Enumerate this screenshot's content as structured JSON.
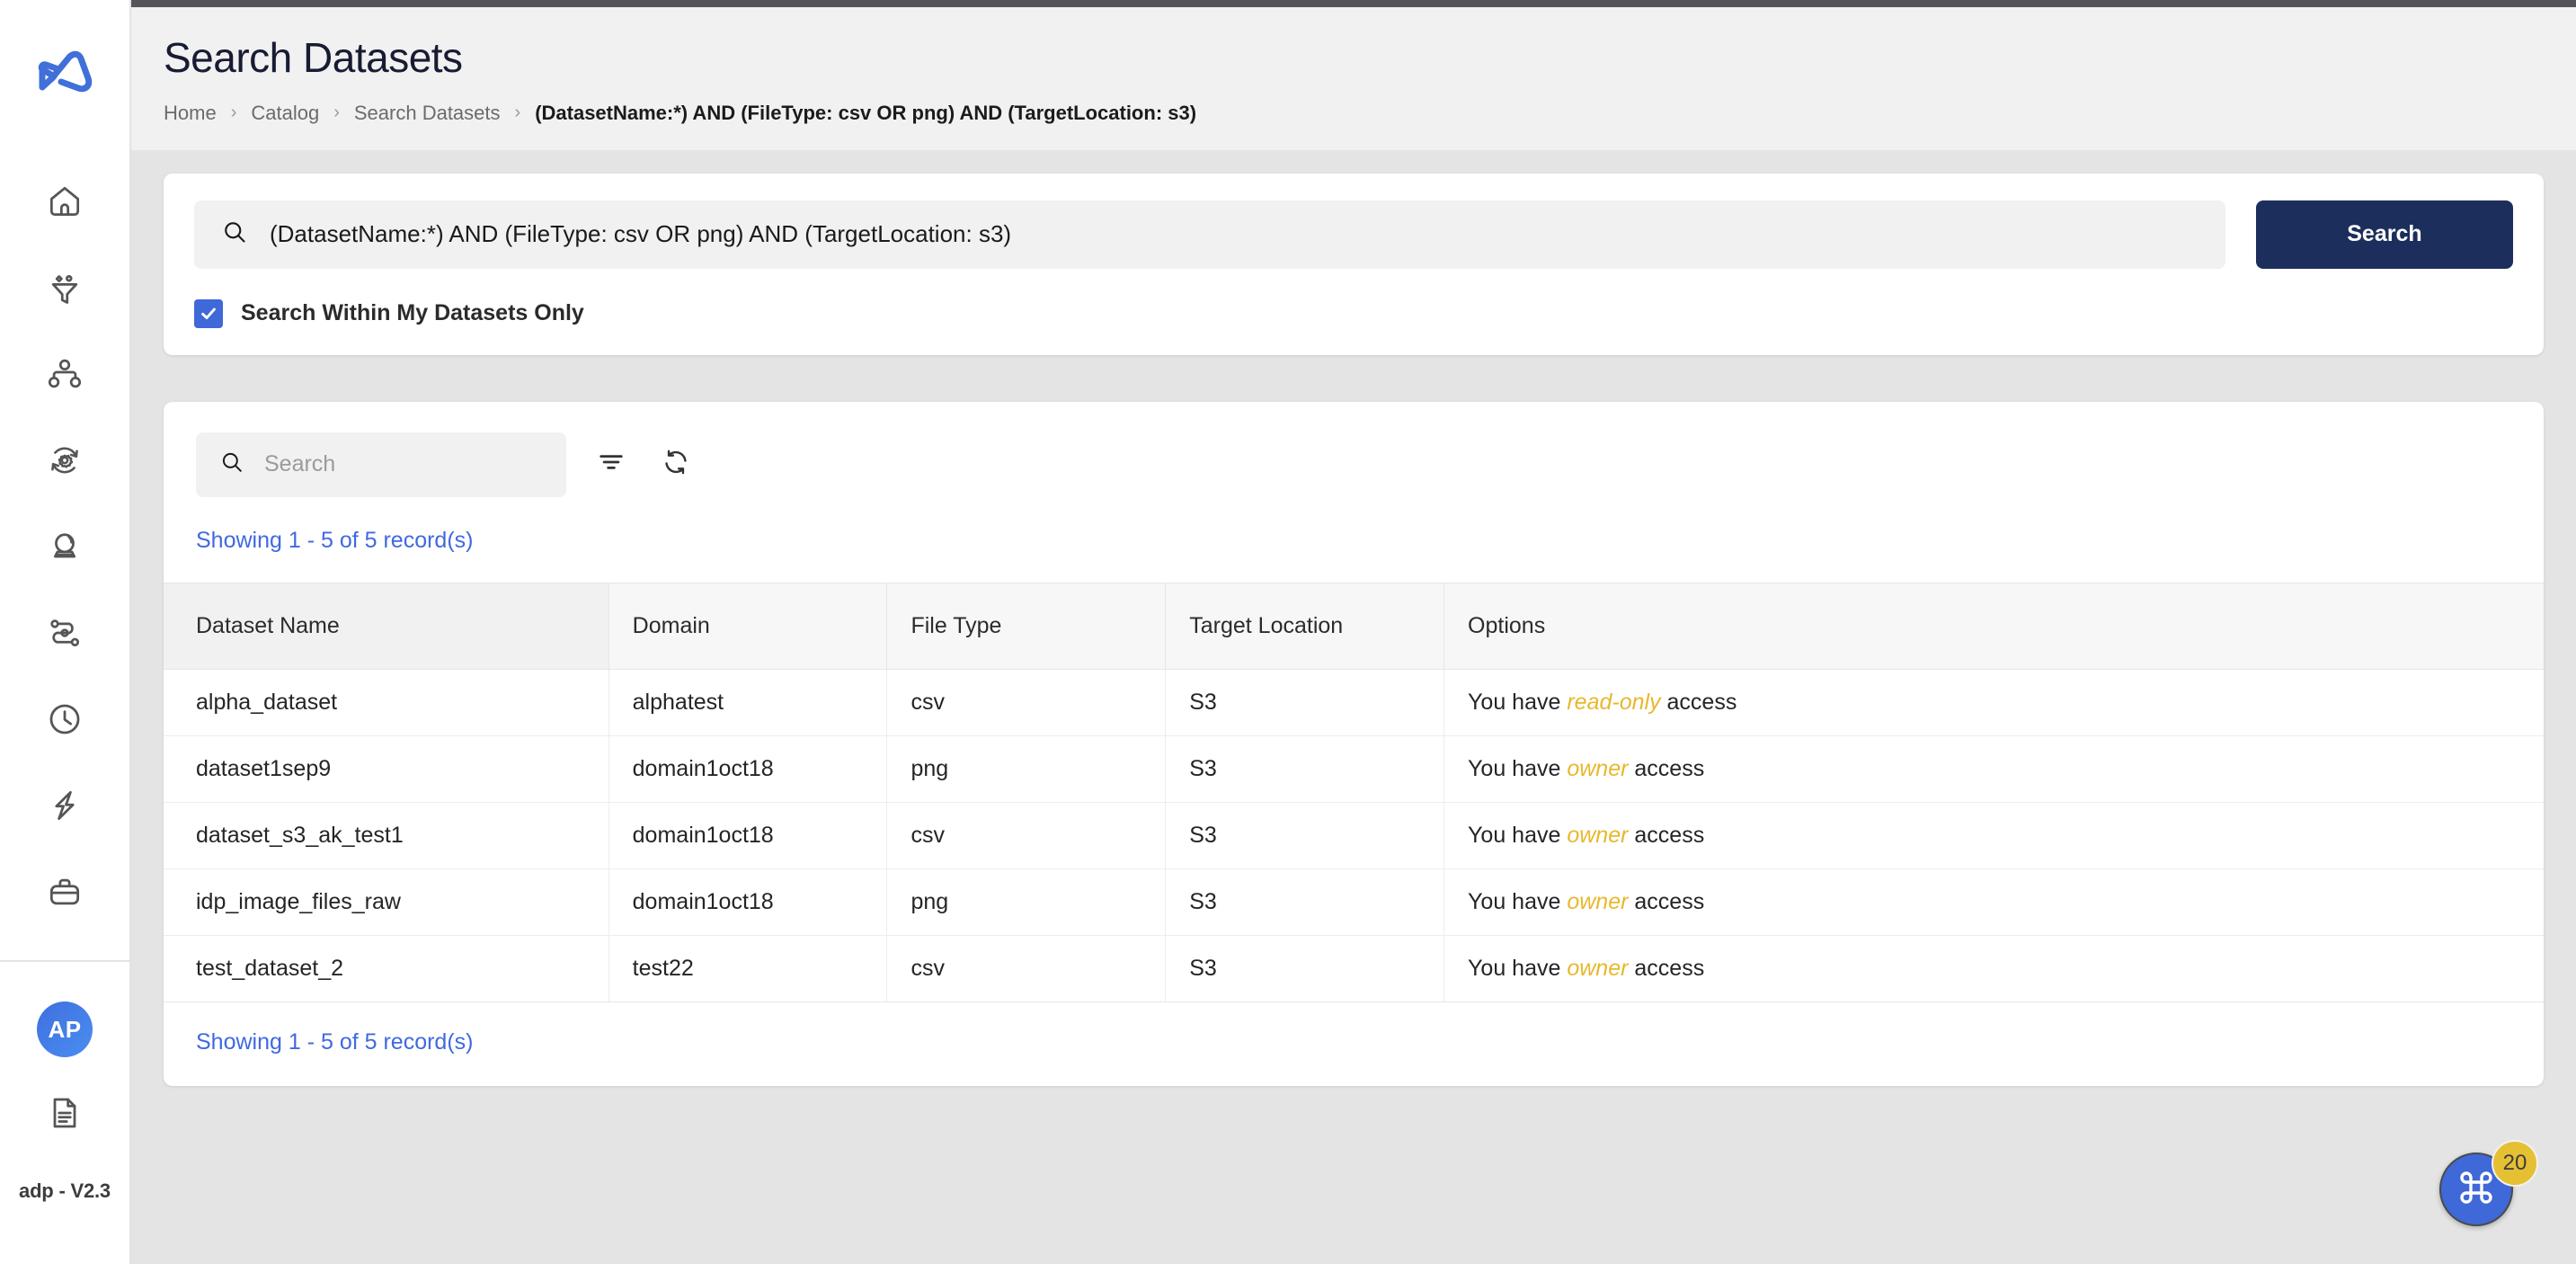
{
  "app": {
    "logo_icon": "adp-logo-icon",
    "version_label": "adp - V2.3",
    "avatar_initials": "AP"
  },
  "sidebar": {
    "items": [
      {
        "name": "home",
        "icon": "home-icon"
      },
      {
        "name": "filter",
        "icon": "funnel-icon"
      },
      {
        "name": "catalog",
        "icon": "hierarchy-icon"
      },
      {
        "name": "processing",
        "icon": "gear-refresh-icon"
      },
      {
        "name": "insights",
        "icon": "crystal-ball-icon"
      },
      {
        "name": "pipelines",
        "icon": "workflow-path-icon"
      },
      {
        "name": "scheduler",
        "icon": "clock-icon"
      },
      {
        "name": "jobs",
        "icon": "lightning-bolt-icon"
      },
      {
        "name": "workspace",
        "icon": "briefcase-icon"
      }
    ],
    "footer_items": [
      {
        "name": "user-avatar",
        "icon": "avatar-icon"
      },
      {
        "name": "docs",
        "icon": "document-icon"
      }
    ]
  },
  "header": {
    "title": "Search Datasets",
    "breadcrumb": [
      {
        "label": "Home",
        "current": false
      },
      {
        "label": "Catalog",
        "current": false
      },
      {
        "label": "Search Datasets",
        "current": false
      },
      {
        "label": "(DatasetName:*) AND (FileType: csv OR png) AND (TargetLocation: s3)",
        "current": true
      }
    ],
    "breadcrumb_separator": "›"
  },
  "search_panel": {
    "query_value": "(DatasetName:*) AND (FileType: csv OR png) AND (TargetLocation: s3)",
    "query_icon": "search-icon",
    "search_button_label": "Search",
    "checkbox_label": "Search Within My Datasets Only",
    "checkbox_checked": true
  },
  "results": {
    "toolbar": {
      "search_placeholder": "Search",
      "search_value": "",
      "search_icon": "search-icon",
      "filter_icon": "filter-icon",
      "refresh_icon": "refresh-icon"
    },
    "record_count_text": "Showing 1 - 5 of 5 record(s)",
    "columns": [
      "Dataset Name",
      "Domain",
      "File Type",
      "Target Location",
      "Options"
    ],
    "rows": [
      {
        "dataset_name": "alpha_dataset",
        "domain": "alphatest",
        "file_type": "csv",
        "target_location": "S3",
        "access_prefix": "You have ",
        "access_role": "read-only",
        "access_suffix": " access"
      },
      {
        "dataset_name": "dataset1sep9",
        "domain": "domain1oct18",
        "file_type": "png",
        "target_location": "S3",
        "access_prefix": "You have ",
        "access_role": "owner",
        "access_suffix": " access"
      },
      {
        "dataset_name": "dataset_s3_ak_test1",
        "domain": "domain1oct18",
        "file_type": "csv",
        "target_location": "S3",
        "access_prefix": "You have ",
        "access_role": "owner",
        "access_suffix": " access"
      },
      {
        "dataset_name": "idp_image_files_raw",
        "domain": "domain1oct18",
        "file_type": "png",
        "target_location": "S3",
        "access_prefix": "You have ",
        "access_role": "owner",
        "access_suffix": " access"
      },
      {
        "dataset_name": "test_dataset_2",
        "domain": "test22",
        "file_type": "csv",
        "target_location": "S3",
        "access_prefix": "You have ",
        "access_role": "owner",
        "access_suffix": " access"
      }
    ]
  },
  "fab": {
    "icon": "command-icon",
    "badge_count": "20"
  },
  "colors": {
    "brand_blue": "#3f68d8",
    "button_navy": "#1c2e5c",
    "link_blue": "#4069e0",
    "role_yellow": "#e8b82c",
    "badge_yellow": "#e5c033",
    "page_bg": "#e4e4e4",
    "header_bg": "#f1f1f1"
  }
}
